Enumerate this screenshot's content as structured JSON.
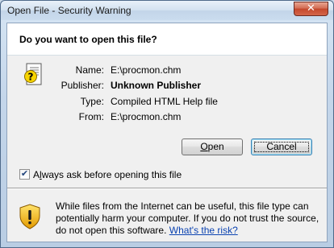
{
  "window": {
    "title": "Open File - Security Warning",
    "close_glyph": "✕"
  },
  "dialog": {
    "question": "Do you want to open this file?",
    "file_icon": "help-file-icon",
    "properties": [
      {
        "label": "Name:",
        "value": "E:\\procmon.chm",
        "bold": false
      },
      {
        "label": "Publisher:",
        "value": "Unknown Publisher",
        "bold": true
      },
      {
        "label": "Type:",
        "value": "Compiled HTML Help file",
        "bold": false
      },
      {
        "label": "From:",
        "value": "E:\\procmon.chm",
        "bold": false
      }
    ],
    "buttons": {
      "open_mnemonic": "O",
      "open_rest": "pen",
      "cancel": "Cancel"
    },
    "checkbox": {
      "checked": true,
      "check_glyph": "✔",
      "label_prefix": "A",
      "label_mnemonic": "l",
      "label_rest": "ways ask before opening this file"
    },
    "warning": {
      "icon": "shield-warning-icon",
      "text": "While files from the Internet can be useful, this file type can potentially harm your computer. If you do not trust the source, do not open this software.",
      "link": "What's the risk?"
    }
  }
}
